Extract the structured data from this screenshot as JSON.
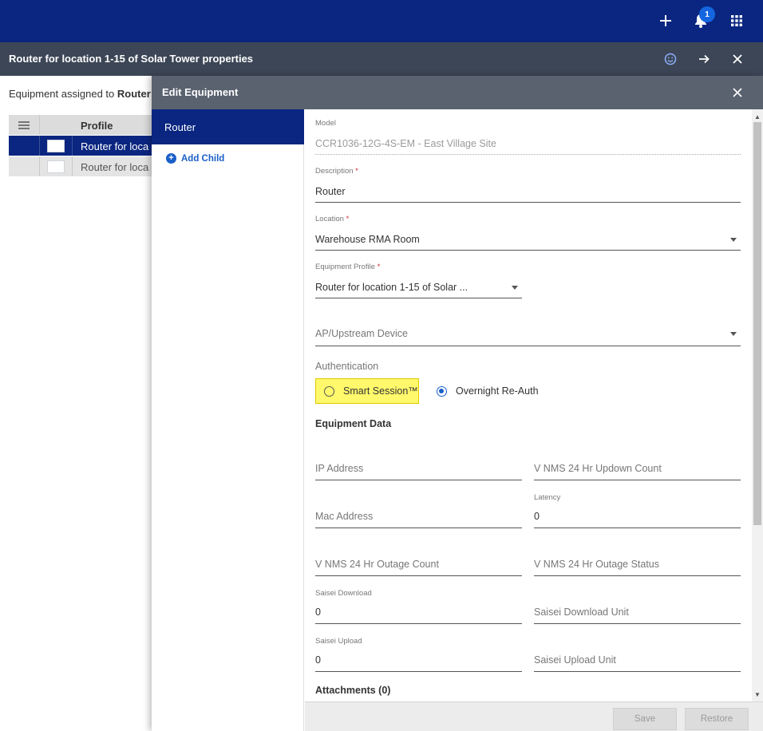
{
  "topbar": {
    "icons": [
      "plus-icon",
      "bell-icon",
      "apps-grid-icon"
    ],
    "notification_count": "1",
    "colors": {
      "primary": "#0a2680",
      "accent": "#1565e0"
    }
  },
  "subbar": {
    "title": "Router for location 1-15 of Solar Tower properties",
    "icons": [
      "smiley-icon",
      "arrow-right-icon",
      "close-icon"
    ]
  },
  "background": {
    "caption_prefix": "Equipment assigned to ",
    "caption_bold": "Router",
    "table": {
      "header": "Profile",
      "rows": [
        "Router for loca",
        "Router for loca"
      ]
    }
  },
  "panel": {
    "title": "Edit Equipment",
    "nav": {
      "selected": "Router",
      "add_child": "Add Child"
    },
    "fields": {
      "model": {
        "label": "Model",
        "value": "CCR1036-12G-4S-EM - East Village Site"
      },
      "description": {
        "label": "Description",
        "required": "*",
        "value": "Router"
      },
      "location": {
        "label": "Location",
        "required": "*",
        "value": "Warehouse RMA Room"
      },
      "equipment_profile": {
        "label": "Equipment Profile",
        "required": "*",
        "value": "Router for location 1-15 of Solar ..."
      },
      "ap_upstream": {
        "placeholder": "AP/Upstream Device"
      }
    },
    "authentication": {
      "label": "Authentication",
      "options": [
        "Smart Session™",
        "Overnight Re-Auth"
      ],
      "selected": "Overnight Re-Auth"
    },
    "equipment_data": {
      "title": "Equipment Data",
      "ip_address": {
        "placeholder": "IP Address"
      },
      "vnms_updown": {
        "placeholder": "V NMS 24 Hr Updown Count"
      },
      "mac_address": {
        "placeholder": "Mac Address"
      },
      "latency": {
        "label": "Latency",
        "value": "0"
      },
      "vnms_outage_count": {
        "placeholder": "V NMS 24 Hr Outage Count"
      },
      "vnms_outage_status": {
        "placeholder": "V NMS 24 Hr Outage Status"
      },
      "saisei_download": {
        "label": "Saisei Download",
        "value": "0"
      },
      "saisei_download_unit": {
        "placeholder": "Saisei Download Unit"
      },
      "saisei_upload": {
        "label": "Saisei Upload",
        "value": "0"
      },
      "saisei_upload_unit": {
        "placeholder": "Saisei Upload Unit"
      }
    },
    "attachments": {
      "title": "Attachments (0)"
    },
    "footer": {
      "save": "Save",
      "restore": "Restore"
    }
  }
}
